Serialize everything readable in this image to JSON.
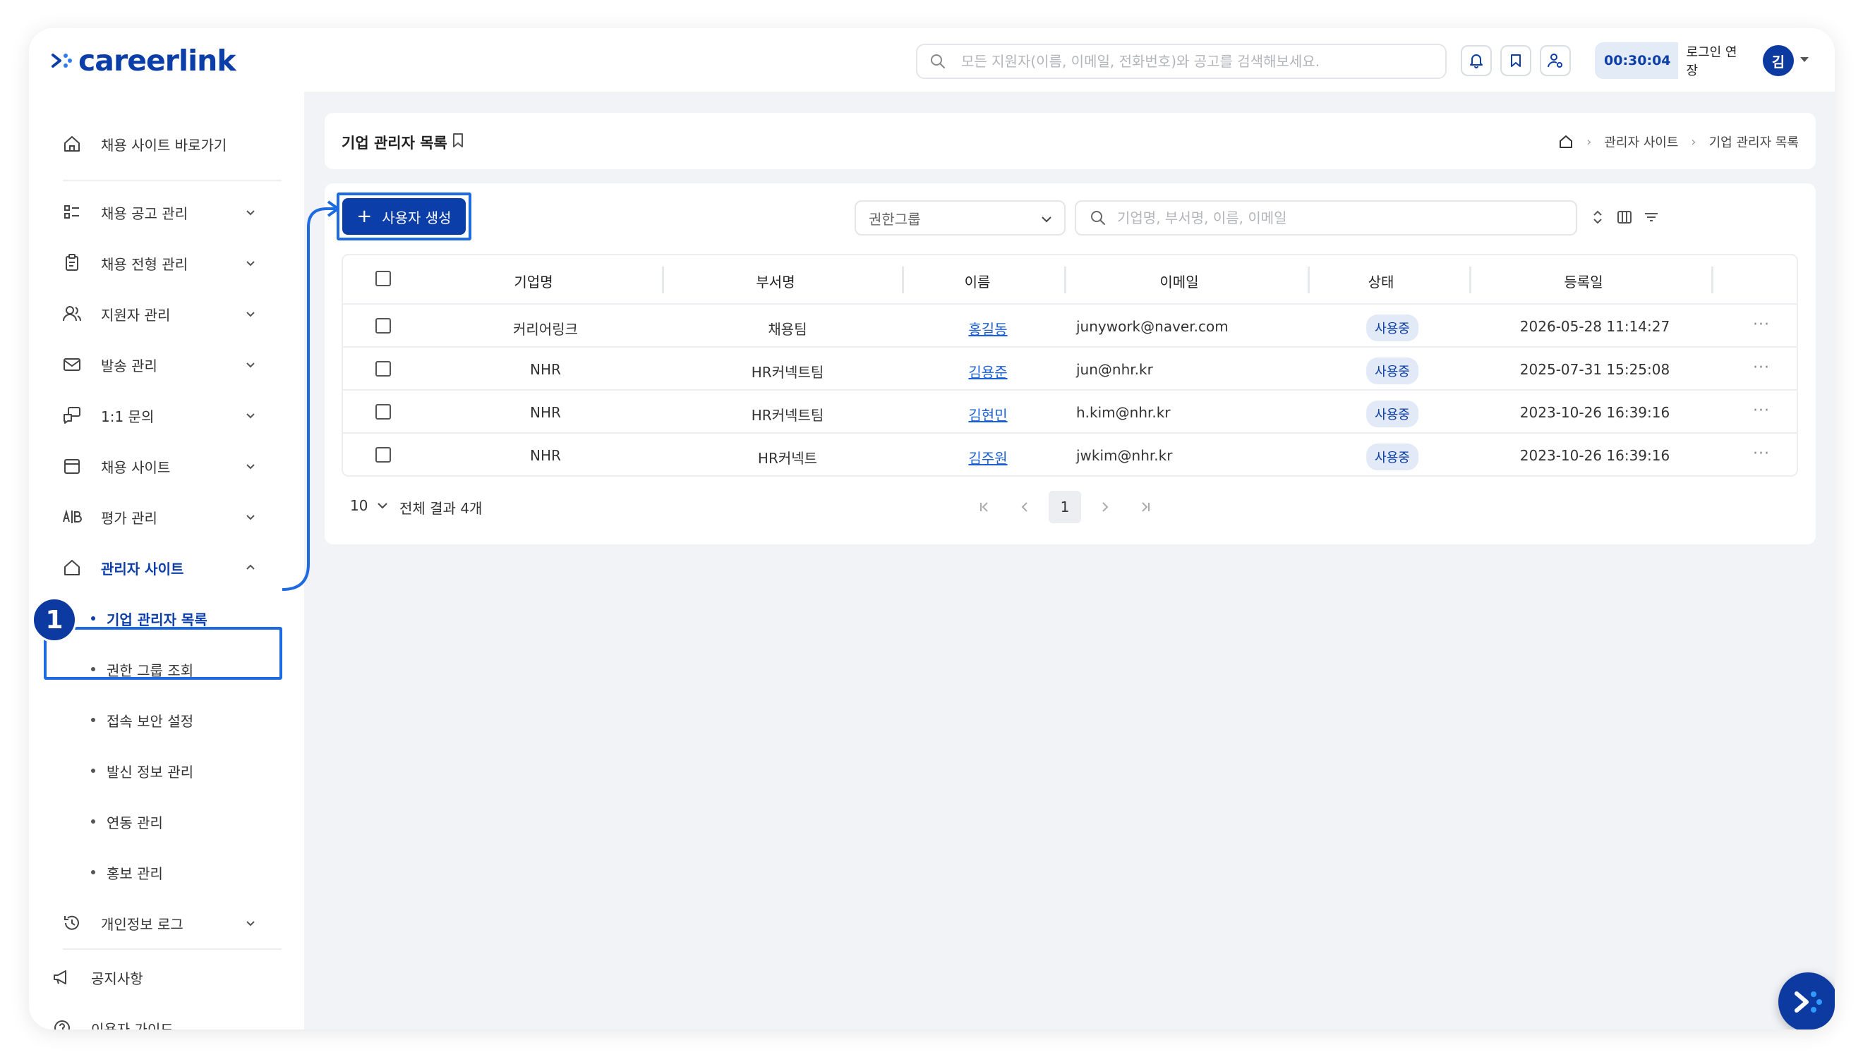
{
  "header": {
    "logo_text": "careerlink",
    "search_placeholder": "모든 지원자(이름, 이메일, 전화번호)와 공고를 검색해보세요.",
    "session_timer": "00:30:04",
    "extend_label": "로그인 연장",
    "avatar_initial": "김"
  },
  "sidebar": {
    "back_link": "채용 사이트 바로가기",
    "items": [
      {
        "label": "채용 공고 관리"
      },
      {
        "label": "채용 전형 관리"
      },
      {
        "label": "지원자 관리"
      },
      {
        "label": "발송 관리"
      },
      {
        "label": "1:1 문의"
      },
      {
        "label": "채용 사이트"
      },
      {
        "label": "평가 관리"
      },
      {
        "label": "관리자 사이트"
      }
    ],
    "admin_sub": [
      {
        "label": "기업 관리자 목록"
      },
      {
        "label": "권한 그룹 조회"
      },
      {
        "label": "접속 보안 설정"
      },
      {
        "label": "발신 정보 관리"
      },
      {
        "label": "연동 관리"
      },
      {
        "label": "홍보 관리"
      }
    ],
    "privacy_log": "개인정보 로그",
    "notice": "공지사항",
    "guide": "이용자 가이드",
    "step_number": "1"
  },
  "page": {
    "title": "기업 관리자 목록",
    "breadcrumb": [
      "관리자 사이트",
      "기업 관리자 목록"
    ]
  },
  "toolbar": {
    "create_label": "사용자 생성",
    "group_select": "권한그룹",
    "search_placeholder": "기업명, 부서명, 이름, 이메일"
  },
  "table": {
    "columns": [
      "기업명",
      "부서명",
      "이름",
      "이메일",
      "상태",
      "등록일"
    ],
    "rows": [
      {
        "company": "커리어링크",
        "dept": "채용팀",
        "name": "홍길동",
        "email": "junywork@naver.com",
        "status": "사용중",
        "date": "2026-05-28 11:14:27"
      },
      {
        "company": "NHR",
        "dept": "HR커넥트팀",
        "name": "김용준",
        "email": "jun@nhr.kr",
        "status": "사용중",
        "date": "2025-07-31 15:25:08"
      },
      {
        "company": "NHR",
        "dept": "HR커넥트팀",
        "name": "김현민",
        "email": "h.kim@nhr.kr",
        "status": "사용중",
        "date": "2023-10-26 16:39:16"
      },
      {
        "company": "NHR",
        "dept": "HR커넥트",
        "name": "김주원",
        "email": "jwkim@nhr.kr",
        "status": "사용중",
        "date": "2023-10-26 16:39:16"
      }
    ],
    "more_glyph": "···"
  },
  "pagination": {
    "page_size": "10",
    "total": "전체 결과 4개",
    "current_page": "1"
  },
  "colors": {
    "brand": "#0b3ea8",
    "highlight": "#1e6ae0",
    "background": "#f1f3f7"
  }
}
